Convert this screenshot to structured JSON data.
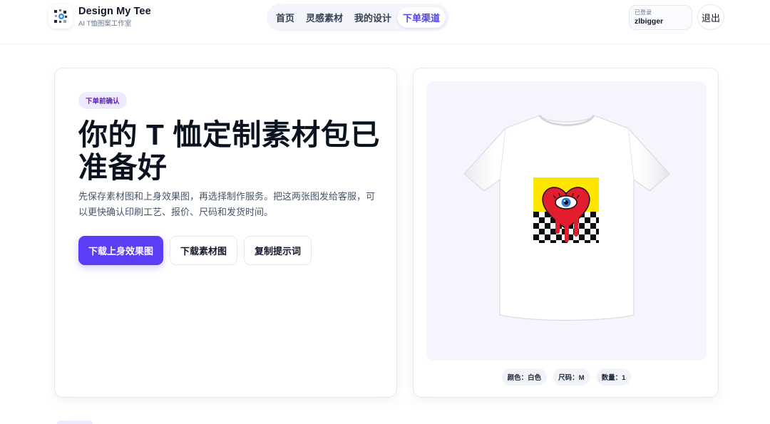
{
  "brand": {
    "title": "Design My Tee",
    "subtitle": "AI T恤图案工作室"
  },
  "nav": {
    "items": [
      {
        "label": "首页",
        "active": false
      },
      {
        "label": "灵感素材",
        "active": false
      },
      {
        "label": "我的设计",
        "active": false
      },
      {
        "label": "下单渠道",
        "active": true
      }
    ]
  },
  "user": {
    "status_label": "已登录",
    "username": "zlbigger",
    "logout_label": "退出"
  },
  "hero": {
    "badge": "下单前确认",
    "headline": "你的 T 恤定制素材包已准备好",
    "description": "先保存素材图和上身效果图，再选择制作服务。把这两张图发给客服，可以更快确认印刷工艺、报价、尺码和发货时间。",
    "buttons": {
      "download_mockup": "下载上身效果图",
      "download_asset": "下载素材图",
      "copy_prompt": "复制提示词"
    }
  },
  "preview": {
    "shirt_color_hex": "#ffffff",
    "specs": {
      "color": "颜色：白色",
      "size": "尺码：M",
      "quantity": "数量：1"
    }
  },
  "colors": {
    "accent": "#5b3df5",
    "nav_active": "#4f46e5",
    "badge_bg": "#ede9fe",
    "print_yellow": "#ffe600",
    "heart_red": "#e11d2e"
  }
}
